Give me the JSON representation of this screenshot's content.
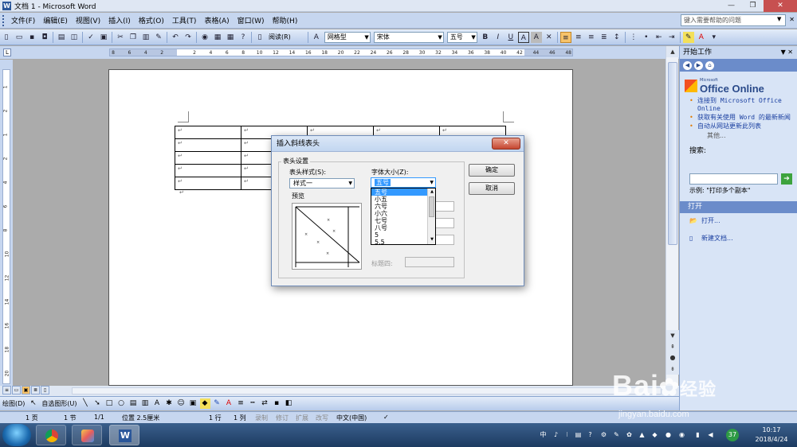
{
  "window": {
    "title": "文档 1 - Microsoft Word",
    "app_icon": "word-icon",
    "controls": [
      "—",
      "❐",
      "✕"
    ]
  },
  "menu": {
    "items": [
      "文件(F)",
      "编辑(E)",
      "视图(V)",
      "插入(I)",
      "格式(O)",
      "工具(T)",
      "表格(A)",
      "窗口(W)",
      "帮助(H)"
    ],
    "help_placeholder": "键入需要帮助的问题",
    "mdi_close": "✕"
  },
  "toolbar": {
    "reading_label": "阅读(R)",
    "style_value": "网格型",
    "font_value": "宋体",
    "size_value": "五号",
    "bold": "B",
    "italic": "I",
    "underline": "U",
    "char_border": "A",
    "char_shade": "A"
  },
  "ruler": {
    "tab_button": "L",
    "horizontal_ticks": [
      "8",
      "6",
      "4",
      "2",
      "",
      "2",
      "4",
      "6",
      "8",
      "10",
      "12",
      "14",
      "16",
      "18",
      "20",
      "22",
      "24",
      "26",
      "28",
      "30",
      "32",
      "34",
      "36",
      "38",
      "40",
      "42",
      "44",
      "46",
      "48"
    ],
    "vertical_ticks": [
      "1",
      "2",
      "1",
      "2",
      "4",
      "6",
      "8",
      "10",
      "12",
      "14",
      "16",
      "18",
      "20"
    ]
  },
  "document": {
    "cell_mark": "↵",
    "para_mark": "↵",
    "rows": 5,
    "cols": 5
  },
  "dialog": {
    "title": "插入斜线表头",
    "close": "✕",
    "group_label": "表头设置",
    "style_label": "表头样式(S):",
    "style_value": "样式一",
    "font_size_label": "字体大小(Z):",
    "font_size_value": "五号",
    "preview_label": "预览",
    "row_title_4_label": "标题四:",
    "ok": "确定",
    "cancel": "取消"
  },
  "font_size_options": [
    "五号",
    "小五",
    "六号",
    "小六",
    "七号",
    "八号",
    "5",
    "5.5"
  ],
  "font_size_selected": "五号",
  "task_pane": {
    "title": "开始工作",
    "brand_small": "Microsoft",
    "brand": "Office Online",
    "links": [
      "连接到 Microsoft Office Online",
      "获取有关使用 Word 的最新新闻",
      "自动从网站更新此列表"
    ],
    "more": "其他...",
    "search_label": "搜索:",
    "example": "示例: \"打印多个副本\"",
    "open_section": "打开",
    "open_action": "打开...",
    "new_doc_action": "新建文档..."
  },
  "drawing": {
    "draw_label": "绘图(D)",
    "autoshapes_label": "自选图形(U)"
  },
  "status": {
    "page": "1 页",
    "section": "1 节",
    "page_of": "1/1",
    "position": "位置 2.5厘米",
    "line": "1 行",
    "column": "1 列",
    "rec": "录制",
    "trk": "修订",
    "ext": "扩展",
    "ovr": "改写",
    "language": "中文(中国)"
  },
  "taskbar": {
    "time": "10:17",
    "date": "2018/4/24",
    "tray_text": "中",
    "badge": "37"
  },
  "watermark": {
    "main": "Bai",
    "main2": "经验",
    "sub": "jingyan.baidu.com"
  }
}
